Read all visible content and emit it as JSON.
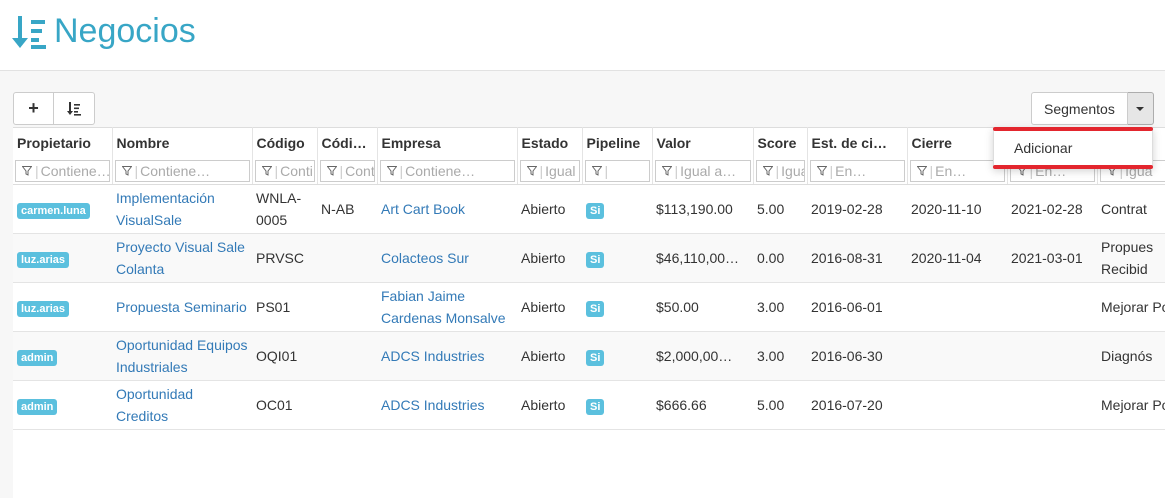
{
  "header": {
    "title": "Negocios",
    "icon": "sort-list-icon",
    "color": "#38a6c6"
  },
  "toolbar": {
    "add_label": "+",
    "sort_icon": "sort-list-icon"
  },
  "segments": {
    "label": "Segmentos",
    "menu": [
      "Adicionar"
    ]
  },
  "columns": [
    "Propietario",
    "Nombre",
    "Código",
    "Códi…",
    "Empresa",
    "Estado",
    "Pipeline",
    "Valor",
    "Score",
    "Est. de ci…",
    "Cierre",
    "",
    ""
  ],
  "filters": [
    "Contiene…",
    "Contiene…",
    "Conti",
    "Conti",
    "Contiene…",
    "Igual",
    "",
    "Igual a…",
    "Igua",
    "En…",
    "En…",
    "En…",
    "Igua"
  ],
  "rows": [
    {
      "owner": "carmen.luna",
      "name": "Implementación VisualSale",
      "code": "WNLA-0005",
      "code2": "N-AB",
      "company": "Art Cart Book",
      "state": "Abierto",
      "pipeline": "Si",
      "value": "$113,190.00",
      "score": "5.00",
      "est": "2019-02-28",
      "close": "2020-11-10",
      "date3": "2021-02-28",
      "stage": "Contrat"
    },
    {
      "owner": "luz.arias",
      "name": "Proyecto Visual Sale Colanta",
      "code": "PRVSC",
      "code2": "",
      "company": "Colacteos Sur",
      "state": "Abierto",
      "pipeline": "Si",
      "value": "$46,110,00…",
      "score": "0.00",
      "est": "2016-08-31",
      "close": "2020-11-04",
      "date3": "2021-03-01",
      "stage": "Propues Recibid"
    },
    {
      "owner": "luz.arias",
      "name": "Propuesta Seminario",
      "code": "PS01",
      "code2": "",
      "company": "Fabian Jaime Cardenas Monsalve",
      "state": "Abierto",
      "pipeline": "Si",
      "value": "$50.00",
      "score": "3.00",
      "est": "2016-06-01",
      "close": "",
      "date3": "",
      "stage": "Mejorar Pos"
    },
    {
      "owner": "admin",
      "name": "Oportunidad Equipos Industriales",
      "code": "OQI01",
      "code2": "",
      "company": "ADCS Industries",
      "state": "Abierto",
      "pipeline": "Si",
      "value": "$2,000,00…",
      "score": "3.00",
      "est": "2016-06-30",
      "close": "",
      "date3": "",
      "stage": "Diagnós"
    },
    {
      "owner": "admin",
      "name": "Oportunidad Creditos",
      "code": "OC01",
      "code2": "",
      "company": "ADCS Industries",
      "state": "Abierto",
      "pipeline": "Si",
      "value": "$666.66",
      "score": "5.00",
      "est": "2016-07-20",
      "close": "",
      "date3": "",
      "stage": "Mejorar Pos"
    }
  ]
}
